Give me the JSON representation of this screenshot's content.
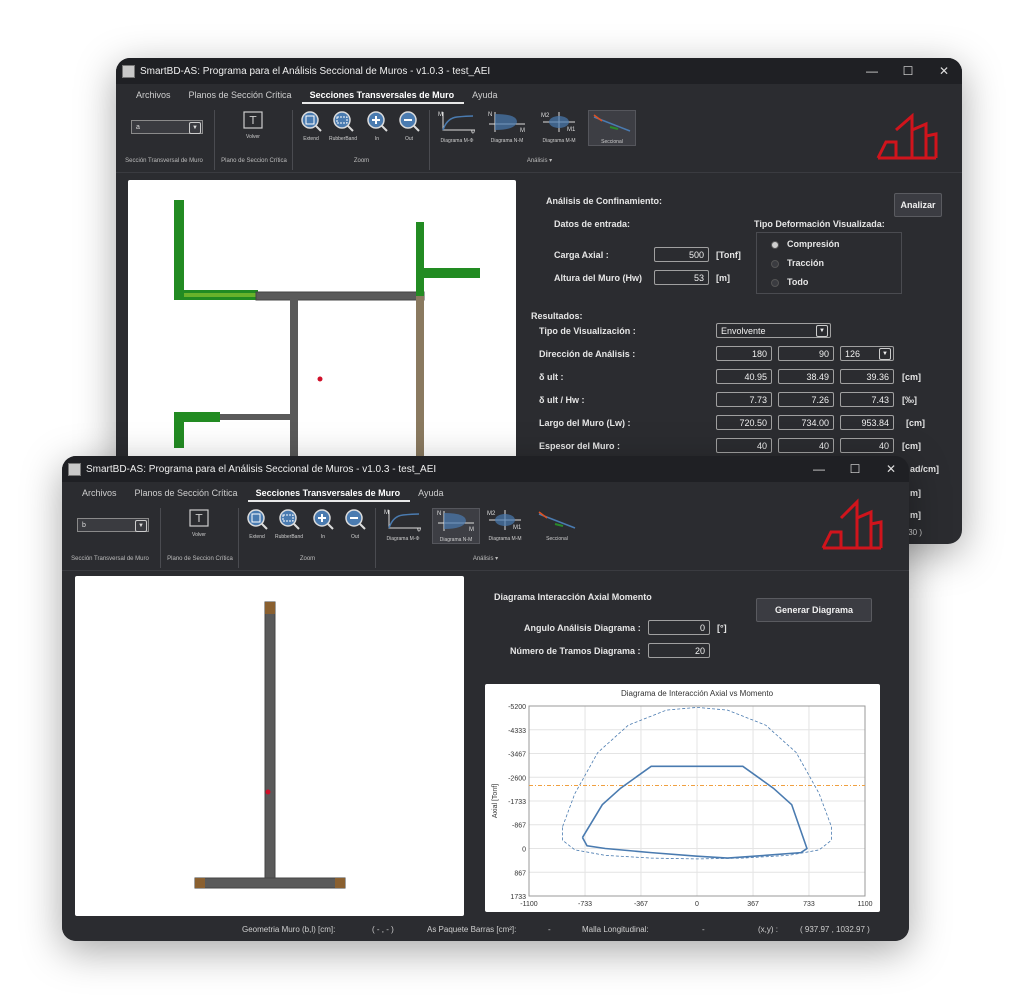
{
  "back": {
    "title": "SmartBD-AS: Programa para el Análisis Seccional de Muros - v1.0.3 - test_AEI",
    "window_controls": {
      "minimize": "—",
      "maximize": "☐",
      "close": "✕"
    },
    "menu": [
      "Archivos",
      "Planos de Sección Crítica",
      "Secciones Transversales de Muro",
      "Ayuda"
    ],
    "ribbon": {
      "section_combo": "a",
      "section_group": "Sección Transversal de Muro",
      "volver": "Volver",
      "plano_group": "Plano de Seccion Crítica",
      "zoom_buttons": [
        "Extend",
        "RubberBand",
        "In",
        "Out"
      ],
      "zoom_group": "Zoom",
      "analysis_buttons": [
        "Diagrama M-Φ",
        "Diagrama N-M",
        "Diagrama M-M",
        "Seccional"
      ],
      "analysis_group": "Análisis",
      "diagram_tags": {
        "m": "M",
        "phi": "φ",
        "n": "N",
        "m2": "M2",
        "m1": "M1"
      }
    },
    "panel": {
      "confinement_title": "Análisis de Confinamiento:",
      "analizar": "Analizar",
      "datos_entrada": "Datos de entrada:",
      "tipo_deform": "Tipo Deformación Visualizada:",
      "carga_axial_label": "Carga Axial :",
      "carga_axial_value": "500",
      "carga_axial_unit": "[Tonf]",
      "altura_label": "Altura del Muro (Hw)",
      "altura_value": "53",
      "altura_unit": "[m]",
      "radios": [
        "Compresión",
        "Tracción",
        "Todo"
      ],
      "resultados": "Resultados:",
      "tipo_vis_label": "Tipo de Visualización :",
      "tipo_vis_value": "Envolvente",
      "direccion_label": "Dirección de Análisis :",
      "direccion_values": [
        "180",
        "90",
        "126"
      ],
      "dult_label": "δ ult :",
      "dult_values": [
        "40.95",
        "38.49",
        "39.36"
      ],
      "dult_unit": "[cm]",
      "dulthw_label": "δ ult / Hw :",
      "dulthw_values": [
        "7.73",
        "7.26",
        "7.43"
      ],
      "dulthw_unit": "[‰]",
      "largo_label": "Largo del Muro (Lw) :",
      "largo_values": [
        "720.50",
        "734.00",
        "953.84"
      ],
      "largo_unit": "[cm]",
      "espesor_label": "Espesor del Muro :",
      "espesor_values": [
        "40",
        "40",
        "40"
      ],
      "espesor_unit": "[cm]",
      "partial_units": [
        "ad/cm]",
        "m]",
        "m]"
      ],
      "partial_status": ".30 )"
    }
  },
  "front": {
    "title": "SmartBD-AS: Programa para el Análisis Seccional de Muros - v1.0.3 - test_AEI",
    "window_controls": {
      "minimize": "—",
      "maximize": "☐",
      "close": "✕"
    },
    "menu": [
      "Archivos",
      "Planos de Sección Crítica",
      "Secciones Transversales de Muro",
      "Ayuda"
    ],
    "ribbon": {
      "section_combo": "b",
      "section_group": "Sección Transversal de Muro",
      "volver": "Volver",
      "plano_group": "Plano de Seccion Crítica",
      "zoom_buttons": [
        "Extend",
        "RubberBand",
        "In",
        "Out"
      ],
      "zoom_group": "Zoom",
      "analysis_buttons": [
        "Diagrama M-Φ",
        "Diagrama N-M",
        "Diagrama M-M",
        "Seccional"
      ],
      "analysis_group": "Análisis",
      "diagram_tags": {
        "m": "M",
        "phi": "φ",
        "n": "N",
        "m2": "M2",
        "m1": "M1"
      }
    },
    "panel": {
      "title": "Diagrama Interacción Axial Momento",
      "generar": "Generar Diagrama",
      "angulo_label": "Angulo Análisis Diagrama :",
      "angulo_value": "0",
      "angulo_unit": "[°]",
      "tramos_label": "Número de Tramos Diagrama :",
      "tramos_value": "20"
    },
    "status": {
      "geom_label": "Geometria Muro (b,l) [cm]:",
      "geom_value": "( - , - )",
      "as_label": "As Paquete Barras [cm²]:",
      "as_value": "-",
      "malla_label": "Malla Longitudinal:",
      "malla_value": "-",
      "xy_label": "(x,y) :",
      "xy_value": "( 937.97 , 1032.97 )"
    }
  },
  "colors": {
    "window_bg": "#2b2c30",
    "titlebar": "#1f2024",
    "logo_red": "#d0141c",
    "wall_gray": "#5a5a5a",
    "wall_green": "#228b22",
    "curve_blue": "#4a7bb0",
    "axial_line": "#f0a040"
  },
  "chart_data": {
    "type": "line",
    "title": "Diagrama de Interacción Axial vs Momento",
    "xlabel": "",
    "ylabel": "Axial [Tonf]",
    "xlim": [
      -1100,
      1100
    ],
    "ylim": [
      1733,
      -5200
    ],
    "x_ticks": [
      "-1100",
      "-733",
      "-367",
      "0",
      "367",
      "733",
      "1100"
    ],
    "y_ticks": [
      "-5200",
      "-4333",
      "-3467",
      "-2600",
      "-1733",
      "-867",
      "0",
      "867",
      "1733"
    ],
    "grid": true,
    "axial_load_line": -2300,
    "series": [
      {
        "style": "dashed",
        "x": [
          -880,
          -800,
          -650,
          -450,
          -200,
          0,
          200,
          450,
          650,
          800,
          880,
          880,
          800,
          600,
          300,
          0,
          -300,
          -600,
          -800,
          -880,
          -880
        ],
        "y": [
          -800,
          -2000,
          -3500,
          -4500,
          -5050,
          -5150,
          -5050,
          -4500,
          -3500,
          -2000,
          -800,
          -300,
          50,
          250,
          350,
          380,
          350,
          250,
          50,
          -300,
          -800
        ]
      },
      {
        "style": "solid",
        "x": [
          -750,
          -620,
          -500,
          -300,
          0,
          300,
          500,
          620,
          720,
          680,
          450,
          200,
          0,
          -300,
          -600,
          -720,
          -750
        ],
        "y": [
          -400,
          -1600,
          -2200,
          -3000,
          -3000,
          -3000,
          -2200,
          -1600,
          0,
          150,
          250,
          350,
          280,
          150,
          0,
          -100,
          -400
        ]
      }
    ]
  }
}
